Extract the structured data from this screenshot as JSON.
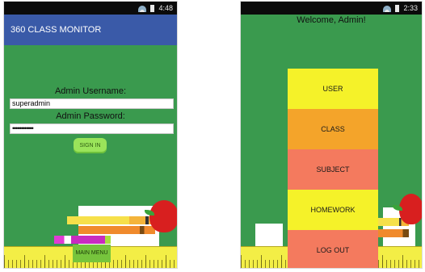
{
  "left_screen": {
    "status_time": "4:48",
    "app_title": "360 CLASS MONITOR",
    "username_label": "Admin Username:",
    "username_value": "superadmin",
    "password_label": "Admin Password:",
    "password_value": "••••••••••••",
    "signin_label": "SIGN IN",
    "main_menu_label": "MAIN MENU"
  },
  "right_screen": {
    "status_time": "2:33",
    "welcome_text": "Welcome, Admin!",
    "menu_items": [
      {
        "label": "USER",
        "color": "#f5f229"
      },
      {
        "label": "CLASS",
        "color": "#f4a42a"
      },
      {
        "label": "SUBJECT",
        "color": "#f47a5e"
      },
      {
        "label": "HOMEWORK",
        "color": "#f5f229"
      },
      {
        "label": "LOG OUT",
        "color": "#f47a5e"
      }
    ]
  },
  "colors": {
    "background_green": "#3a9a4e",
    "appbar_blue": "#3a5aa8",
    "statusbar": "#0b0b0b",
    "signin_green": "#9ae45a",
    "ruler_yellow": "#f3ee46",
    "apple_red": "#d81f1f"
  },
  "icons": [
    "wifi-icon",
    "battery-icon",
    "apple-icon",
    "pencil-icon",
    "ruler-icon"
  ]
}
